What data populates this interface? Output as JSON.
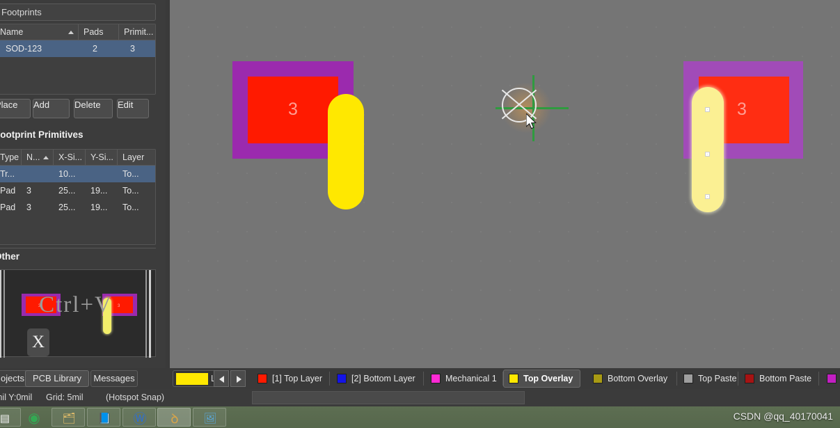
{
  "panel": {
    "search": {
      "value": "Footprints",
      "placeholder": "Footprints"
    },
    "footprints_grid": {
      "columns": [
        "Name",
        "Pads",
        "Primit..."
      ],
      "rows": [
        {
          "name": "SOD-123",
          "pads": "2",
          "primitives": "3",
          "selected": true
        }
      ]
    },
    "buttons": {
      "place": "Place",
      "add": "Add",
      "delete": "Delete",
      "edit": "Edit"
    },
    "primitives_title": "Footprint Primitives",
    "primitives_grid": {
      "columns": [
        "Type",
        "N...",
        "X-Si...",
        "Y-Si...",
        "Layer"
      ],
      "rows": [
        {
          "type": "Tr...",
          "n": "",
          "x": "10...",
          "y": "",
          "layer": "To...",
          "selected": true
        },
        {
          "type": "Pad",
          "n": "3",
          "x": "25...",
          "y": "19...",
          "layer": "To...",
          "selected": false
        },
        {
          "type": "Pad",
          "n": "3",
          "x": "25...",
          "y": "19...",
          "layer": "To...",
          "selected": false
        }
      ]
    },
    "other_title": "Other",
    "other_preview": {
      "keystroke": "Ctrl+V",
      "key_badge": "X",
      "pad_label_left": "3",
      "pad_label_right": "3"
    }
  },
  "canvas": {
    "left_footprint": {
      "pad_number": "3"
    },
    "right_footprint": {
      "pad_number": "3",
      "selected": true,
      "handle_count": 3
    },
    "colors": {
      "background": "#757575",
      "mechanical": "#9b2aae",
      "top_layer_pad": "#ff1a00",
      "top_overlay_track": "#ffe800",
      "selection_track": "#fbf093",
      "crosshair": "#2f9b3f"
    }
  },
  "layer_bar": {
    "doc_tabs": [
      {
        "label": "ojects",
        "active": false
      },
      {
        "label": "PCB Library",
        "active": true
      },
      {
        "label": "Messages",
        "active": false
      }
    ],
    "ls": {
      "label": "LS",
      "color": "#ffe800"
    },
    "nav": {
      "prev": "prev-layer",
      "next": "next-layer"
    },
    "layers": [
      {
        "label": "[1] Top Layer",
        "color": "#ff1a00",
        "active": false
      },
      {
        "label": "[2] Bottom Layer",
        "color": "#1414e6",
        "active": false
      },
      {
        "label": "Mechanical 1",
        "color": "#ff2ad4",
        "active": false
      },
      {
        "label": "Top Overlay",
        "color": "#ffe800",
        "active": true
      },
      {
        "label": "Bottom Overlay",
        "color": "#a89a14",
        "active": false
      },
      {
        "label": "Top Paste",
        "color": "#9e9e9e",
        "active": false
      },
      {
        "label": "Bottom Paste",
        "color": "#a61313",
        "active": false
      },
      {
        "label": "",
        "color": "#c21fc2",
        "active": false
      }
    ]
  },
  "status_bar": {
    "coords": "mil Y:0mil",
    "grid": "Grid: 5mil",
    "snap": "(Hotspot Snap)"
  },
  "taskbar": {
    "items": [
      {
        "name": "start-menu",
        "glyph": "▤",
        "color": "#f2f2f2",
        "active": false
      },
      {
        "name": "chrome",
        "glyph": "◉",
        "color": "#34a853",
        "active": false
      },
      {
        "name": "file-explorer",
        "glyph": "🗂",
        "color": "#e8c06a",
        "active": false
      },
      {
        "name": "notepad",
        "glyph": "📘",
        "color": "#8fc7e8",
        "active": false
      },
      {
        "name": "wps-office",
        "glyph": "Ⓦ",
        "color": "#2f6fd0",
        "active": false
      },
      {
        "name": "altium-designer",
        "glyph": "ꝺ",
        "color": "#d7a44a",
        "active": true
      },
      {
        "name": "photo-viewer",
        "glyph": "🖼",
        "color": "#5ba7d8",
        "active": false
      }
    ]
  },
  "watermark": "CSDN @qq_40170041"
}
